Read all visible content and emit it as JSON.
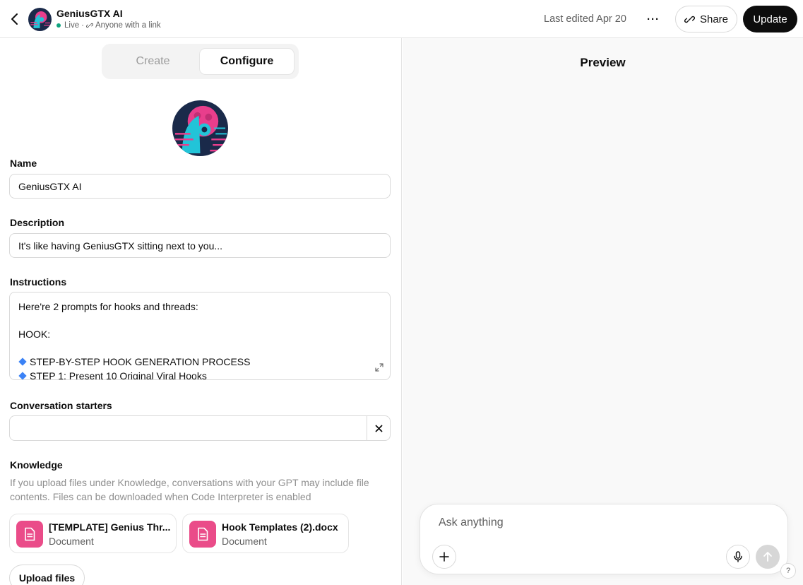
{
  "header": {
    "app_title": "GeniusGTX AI",
    "status_live": "Live",
    "status_separator": "·",
    "status_visibility": "Anyone with a link",
    "last_edited": "Last edited Apr 20",
    "more_label": "···",
    "share_label": "Share",
    "update_label": "Update"
  },
  "tabs": {
    "create": "Create",
    "configure": "Configure",
    "active": "Configure"
  },
  "form": {
    "name_label": "Name",
    "name_value": "GeniusGTX AI",
    "description_label": "Description",
    "description_value": "It's like having GeniusGTX sitting next to you...",
    "instructions_label": "Instructions",
    "instructions_lines": [
      "Here're 2 prompts for hooks and threads:",
      "",
      "HOOK:",
      "",
      "STEP-BY-STEP HOOK GENERATION PROCESS",
      "STEP 1: Present 10 Original Viral Hooks"
    ],
    "starters_label": "Conversation starters",
    "starter_value": "",
    "knowledge_label": "Knowledge",
    "knowledge_description": "If you upload files under Knowledge, conversations with your GPT may include file contents. Files can be downloaded when Code Interpreter is enabled",
    "files": [
      {
        "name": "[TEMPLATE] Genius Thr...",
        "type": "Document"
      },
      {
        "name": "Hook Templates (2).docx",
        "type": "Document"
      }
    ],
    "upload_label": "Upload files"
  },
  "preview": {
    "title": "Preview",
    "composer_placeholder": "Ask anything",
    "help_label": "?"
  },
  "colors": {
    "live_dot": "#10a37f",
    "file_icon_bg": "#ea4c89",
    "update_bg": "#0d0d0d",
    "diamond": "#3b82f6",
    "avatar_bg": "#1a2a4a",
    "avatar_pink": "#e83e8c",
    "avatar_cyan": "#22c4d8"
  },
  "icons": {
    "back": "chevron-left-icon",
    "link": "link-icon",
    "expand": "expand-icon",
    "close": "close-icon",
    "document": "document-icon",
    "plus": "plus-icon",
    "mic": "microphone-icon",
    "send": "arrow-up-icon"
  }
}
